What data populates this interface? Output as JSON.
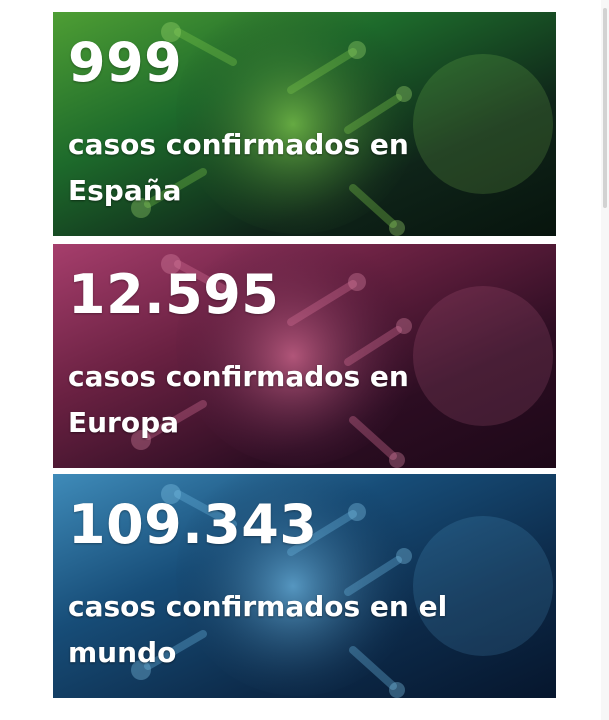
{
  "cards": [
    {
      "count": "999",
      "label_line1": "casos confirmados en",
      "label_line2": "España",
      "theme": "green",
      "colors": {
        "dark": "#07140d",
        "mid": "#1d6a2b",
        "accent": "#6fc344"
      }
    },
    {
      "count": "12.595",
      "label_line1": "casos confirmados en",
      "label_line2": "Europa",
      "theme": "magenta",
      "colors": {
        "dark": "#1d0818",
        "mid": "#6a2142",
        "accent": "#c9577b"
      }
    },
    {
      "count": "109.343",
      "label_line1": "casos confirmados en el",
      "label_line2": "mundo",
      "theme": "blue",
      "colors": {
        "dark": "#06162d",
        "mid": "#174d78",
        "accent": "#5da3d0"
      }
    }
  ],
  "decorations": {
    "background_icon": "coronavirus-icon"
  }
}
